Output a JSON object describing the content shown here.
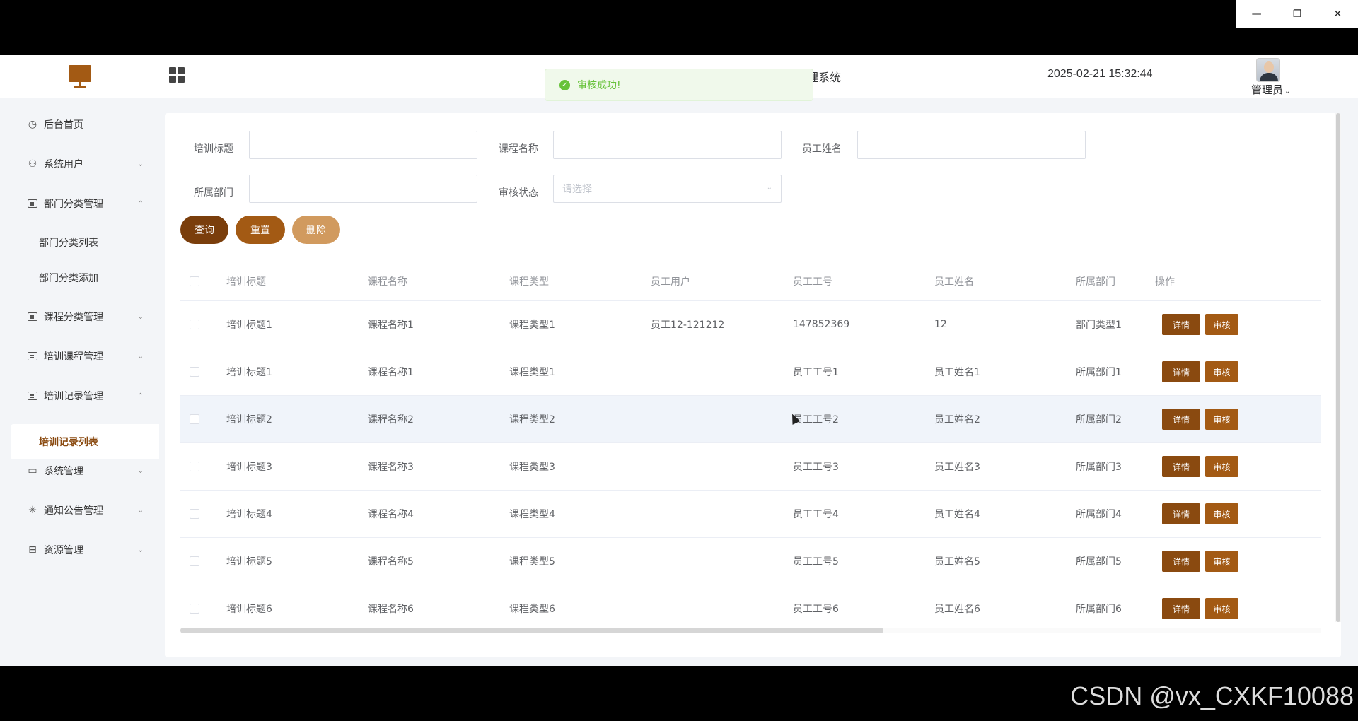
{
  "window": {
    "minimize": "—",
    "restore": "❐",
    "close": "✕"
  },
  "header": {
    "system_title": "理系统",
    "datetime": "2025-02-21 15:32:44",
    "user": "管理员",
    "user_caret": "⌄"
  },
  "toast": {
    "icon": "✓",
    "message": "审核成功!"
  },
  "sidebar": {
    "items": [
      {
        "label": "后台首页",
        "icon": "clock-icon"
      },
      {
        "label": "系统用户",
        "icon": "user-icon",
        "arrow": "⌄"
      },
      {
        "label": "部门分类管理",
        "icon": "list-icon",
        "arrow": "⌃"
      },
      {
        "label": "部门分类列表"
      },
      {
        "label": "部门分类添加"
      },
      {
        "label": "课程分类管理",
        "icon": "list-icon",
        "arrow": "⌄"
      },
      {
        "label": "培训课程管理",
        "icon": "list-icon",
        "arrow": "⌄"
      },
      {
        "label": "培训记录管理",
        "icon": "list-icon",
        "arrow": "⌃"
      },
      {
        "label": "培训记录列表",
        "active": true
      },
      {
        "label": "系统管理",
        "icon": "folder-icon",
        "arrow": "⌄"
      },
      {
        "label": "通知公告管理",
        "icon": "loader-icon",
        "arrow": "⌄"
      },
      {
        "label": "资源管理",
        "icon": "box-icon",
        "arrow": "⌄"
      }
    ]
  },
  "filters": {
    "title_label": "培训标题",
    "course_label": "课程名称",
    "employee_name_label": "员工姓名",
    "department_label": "所属部门",
    "status_label": "审核状态",
    "status_placeholder": "请选择",
    "status_arrow": "⌄"
  },
  "actions": {
    "query": "查询",
    "reset": "重置",
    "delete": "删除",
    "colors": {
      "query": "#7a3e0c",
      "reset": "#a35a14",
      "delete": "#d19a5e"
    }
  },
  "table": {
    "headers": [
      "培训标题",
      "课程名称",
      "课程类型",
      "员工用户",
      "员工工号",
      "员工姓名",
      "所属部门",
      "操作"
    ],
    "rows": [
      [
        "培训标题1",
        "课程名称1",
        "课程类型1",
        "员工12-121212",
        "147852369",
        "12",
        "部门类型1"
      ],
      [
        "培训标题1",
        "课程名称1",
        "课程类型1",
        "",
        "员工工号1",
        "员工姓名1",
        "所属部门1"
      ],
      [
        "培训标题2",
        "课程名称2",
        "课程类型2",
        "",
        "员工工号2",
        "员工姓名2",
        "所属部门2"
      ],
      [
        "培训标题3",
        "课程名称3",
        "课程类型3",
        "",
        "员工工号3",
        "员工姓名3",
        "所属部门3"
      ],
      [
        "培训标题4",
        "课程名称4",
        "课程类型4",
        "",
        "员工工号4",
        "员工姓名4",
        "所属部门4"
      ],
      [
        "培训标题5",
        "课程名称5",
        "课程类型5",
        "",
        "员工工号5",
        "员工姓名5",
        "所属部门5"
      ],
      [
        "培训标题6",
        "课程名称6",
        "课程类型6",
        "",
        "员工工号6",
        "员工姓名6",
        "所属部门6"
      ]
    ],
    "detail_label": "详情",
    "audit_label": "审核"
  },
  "watermark": "CSDN @vx_CXKF10088"
}
